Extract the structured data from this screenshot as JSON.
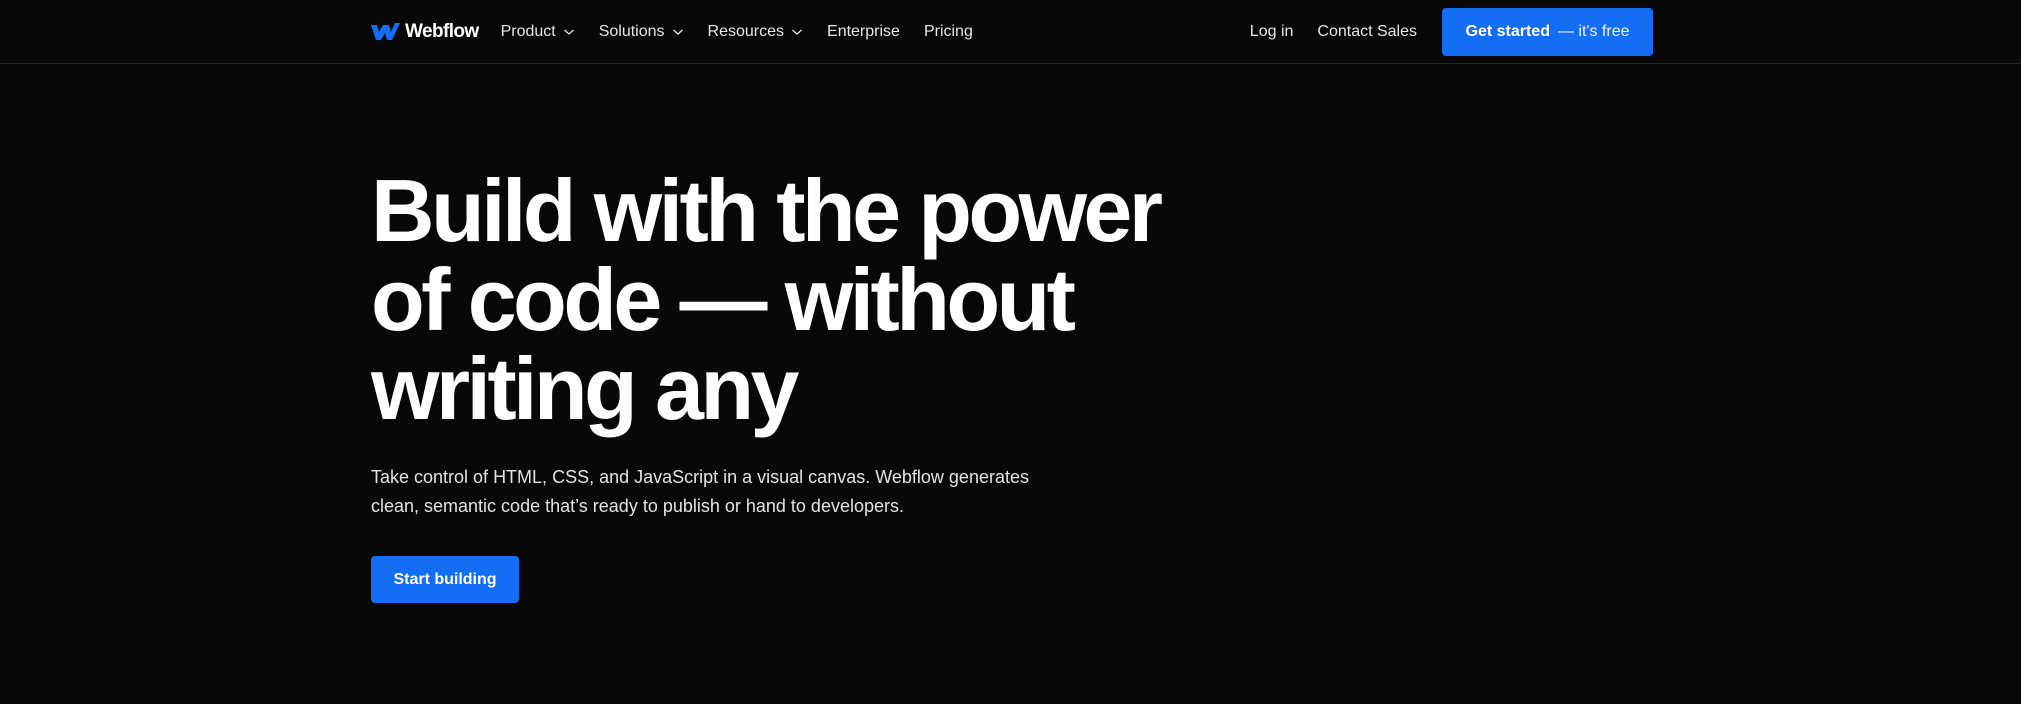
{
  "brand": {
    "name": "Webflow",
    "logo_icon": "webflow-w-logo-icon",
    "logo_color": "#146ef5"
  },
  "nav": {
    "items": [
      {
        "label": "Product",
        "dropdown": true
      },
      {
        "label": "Solutions",
        "dropdown": true
      },
      {
        "label": "Resources",
        "dropdown": true
      },
      {
        "label": "Enterprise",
        "dropdown": false
      },
      {
        "label": "Pricing",
        "dropdown": false
      }
    ],
    "login_label": "Log in",
    "contact_label": "Contact Sales",
    "cta": {
      "strong": "Get started",
      "light": "— it's free"
    }
  },
  "hero": {
    "title_lines": [
      "Build with the power",
      "of code — without",
      "writing any"
    ],
    "subtitle": "Take control of HTML, CSS, and JavaScript in a visual canvas. Webflow generates clean, semantic code that’s ready to publish or hand to developers.",
    "button_label": "Start building"
  },
  "colors": {
    "background": "#080808",
    "accent": "#146ef5",
    "text": "#ffffff",
    "divider": "#262626"
  }
}
